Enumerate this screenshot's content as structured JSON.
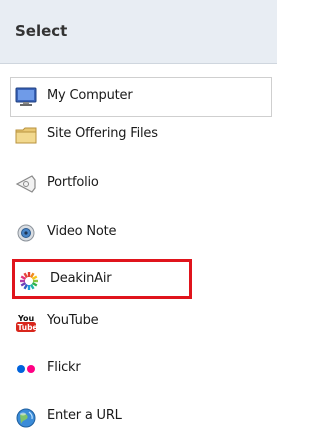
{
  "header": {
    "title": "Select"
  },
  "items": [
    {
      "label": "My Computer",
      "icon": "computer-icon"
    },
    {
      "label": "Site Offering Files",
      "icon": "folder-icon"
    },
    {
      "label": "Portfolio",
      "icon": "portfolio-icon"
    },
    {
      "label": "Video Note",
      "icon": "webcam-icon"
    },
    {
      "label": "DeakinAir",
      "icon": "deakinair-icon"
    },
    {
      "label": "YouTube",
      "icon": "youtube-icon"
    },
    {
      "label": "Flickr",
      "icon": "flickr-icon"
    },
    {
      "label": "Enter a URL",
      "icon": "globe-icon"
    }
  ],
  "colors": {
    "highlight_border": "#e0141c",
    "header_background": "#e8edf3"
  }
}
